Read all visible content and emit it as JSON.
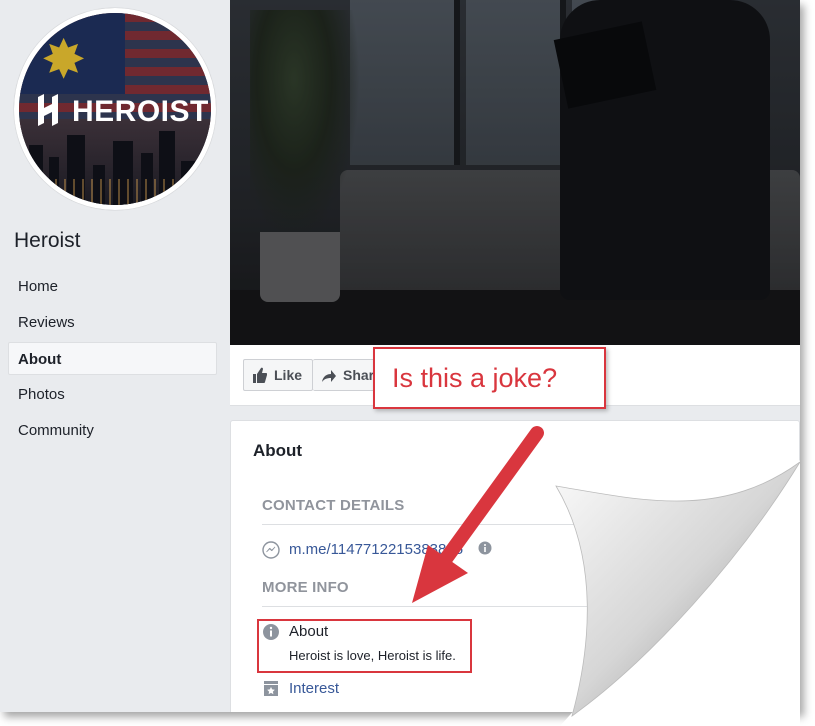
{
  "page": {
    "name": "Heroist",
    "logo_text": "HEROIST"
  },
  "sidebar": {
    "items": [
      {
        "label": "Home"
      },
      {
        "label": "Reviews"
      },
      {
        "label": "About",
        "active": true
      },
      {
        "label": "Photos"
      },
      {
        "label": "Community"
      }
    ]
  },
  "actions": {
    "like_label": "Like",
    "share_label": "Share"
  },
  "about": {
    "title": "About",
    "contact_heading": "CONTACT DETAILS",
    "messenger_link": "m.me/1147712215383815",
    "more_info_heading": "MORE INFO",
    "about_label": "About",
    "about_text": "Heroist is love, Heroist is life.",
    "interest_label": "Interest"
  },
  "annotation": {
    "callout_text": "Is this a joke?",
    "color": "#d9363e"
  },
  "icons": {
    "like": "thumbs-up-icon",
    "share": "share-arrow-icon",
    "messenger": "messenger-icon",
    "info": "info-icon",
    "interest": "interest-star-icon"
  },
  "colors": {
    "link": "#385898",
    "page_bg": "#e9ebee",
    "heading_gray": "#90949c"
  }
}
